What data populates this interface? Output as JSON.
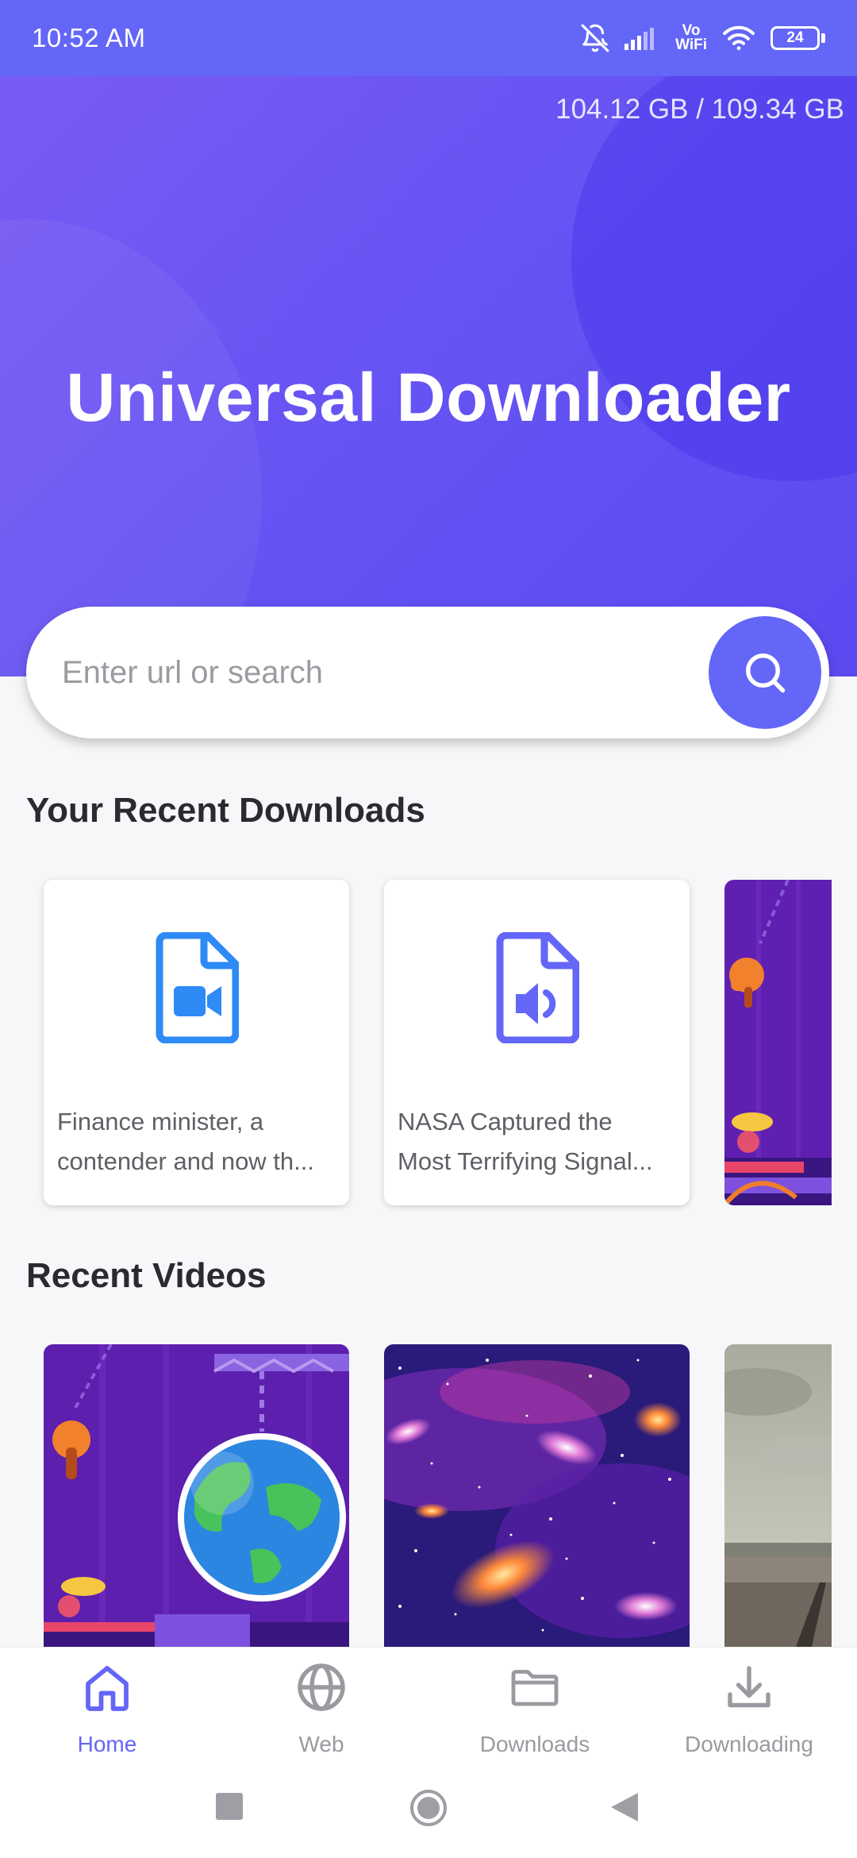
{
  "status_bar": {
    "time": "10:52 AM",
    "icons": [
      "mute-bell-icon",
      "signal-icon",
      "vowifi-icon",
      "wifi-icon",
      "battery-icon"
    ],
    "vowifi_top": "Vo",
    "vowifi_bottom": "WiFi",
    "battery_level": "24"
  },
  "header": {
    "storage": "104.12 GB / 109.34 GB",
    "title": "Universal Downloader"
  },
  "search": {
    "placeholder": "Enter url or search",
    "button_icon": "search-icon"
  },
  "recent_downloads": {
    "title": "Your Recent Downloads",
    "items": [
      {
        "type": "video",
        "icon": "video-file-icon",
        "line1": "Finance minister, a",
        "line2": "contender and now th..."
      },
      {
        "type": "audio",
        "icon": "audio-file-icon",
        "line1": "NASA Captured the",
        "line2": "Most Terrifying Signal..."
      },
      {
        "type": "thumbnail",
        "icon": "video-thumbnail"
      }
    ]
  },
  "recent_videos": {
    "title": "Recent Videos",
    "items": [
      "earth-cartoon-thumbnail",
      "galaxy-thumbnail",
      "landscape-thumbnail"
    ]
  },
  "bottom_nav": [
    {
      "label": "Home",
      "icon": "home-icon",
      "active": true
    },
    {
      "label": "Web",
      "icon": "globe-icon",
      "active": false
    },
    {
      "label": "Downloads",
      "icon": "folder-icon",
      "active": false
    },
    {
      "label": "Downloading",
      "icon": "download-icon",
      "active": false
    }
  ],
  "colors": {
    "accent": "#6366f6",
    "video_icon": "#2e8af5",
    "audio_icon": "#6366f6"
  }
}
